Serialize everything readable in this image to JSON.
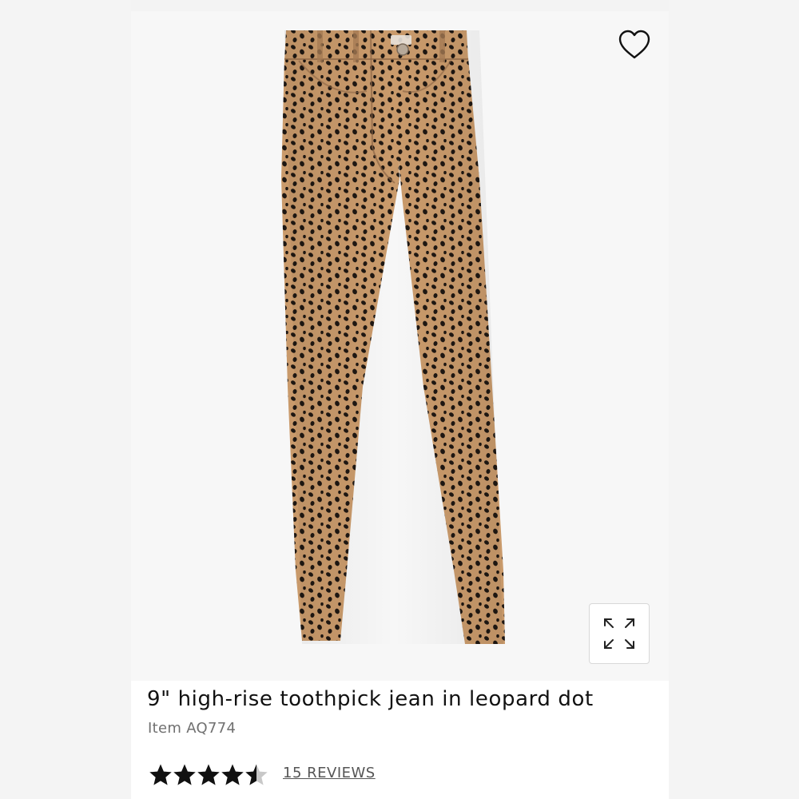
{
  "product": {
    "title": "9\" high-rise toothpick jean in leopard dot",
    "item_number": "Item AQ774",
    "rating": 4.5,
    "rating_max": 5,
    "reviews_label": "15 REVIEWS",
    "image_subject": "leopard-dot-jeans"
  },
  "icons": {
    "wishlist": "heart-outline-icon",
    "expand": "expand-arrows-icon",
    "star": "star-icon"
  },
  "colors": {
    "fabric_base": "#c99a6b",
    "fabric_dots": "#1e1712",
    "star": "#111111",
    "star_empty": "#c8c8c8",
    "background": "#f7f7f7"
  }
}
